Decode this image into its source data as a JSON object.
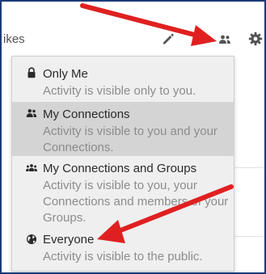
{
  "topbar": {
    "partial_text": "ikes"
  },
  "dropdown": {
    "items": [
      {
        "icon": "lock-icon",
        "title": "Only Me",
        "description": "Activity is visible only to you."
      },
      {
        "icon": "connections-icon",
        "title": "My Connections",
        "description": "Activity is visible to you and your Connections."
      },
      {
        "icon": "groups-icon",
        "title": "My Connections and Groups",
        "description": "Activity is visible to you, your Connections and members of your Groups."
      },
      {
        "icon": "globe-icon",
        "title": "Everyone",
        "description": "Activity is visible to the public."
      }
    ],
    "selected": "My Connections"
  },
  "colors": {
    "frame_border": "#1c3a7a",
    "annotation_arrow": "#e02020",
    "selected_row": "#d4d4d4",
    "menu_background": "#efefef"
  }
}
